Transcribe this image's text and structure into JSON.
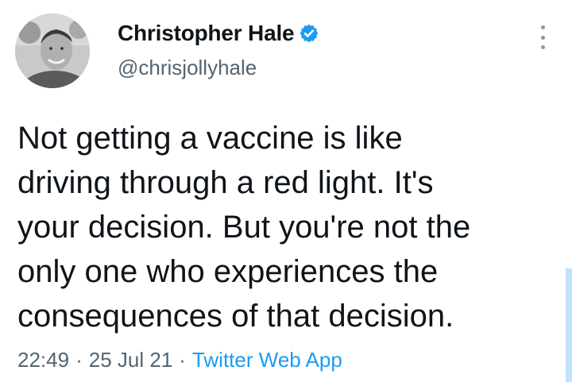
{
  "user": {
    "display_name": "Christopher Hale",
    "handle": "@chrisjollyhale",
    "avatar_icon": "profile-photo",
    "verified_icon": "verified-badge-icon",
    "verified_color": "#1d9bf0"
  },
  "tweet": {
    "text_lines": [
      "Not getting a vaccine is like",
      "driving through a red light. It's",
      "your decision. But you're not the",
      "only one who experiences the",
      "consequences of that decision."
    ],
    "time": "22:49",
    "separator": "·",
    "date": "25 Jul 21",
    "source": "Twitter Web App"
  },
  "menu": {
    "icon": "more-vertical-icon"
  },
  "colors": {
    "text_primary": "#0f1419",
    "text_secondary": "#536471",
    "link": "#1d9bf0"
  }
}
